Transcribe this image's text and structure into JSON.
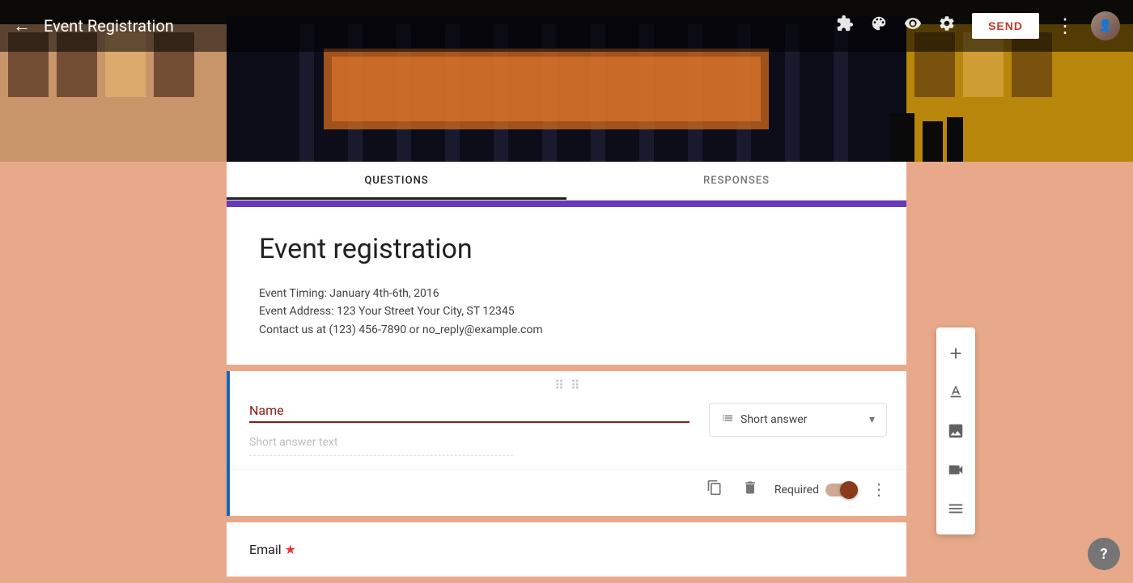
{
  "header": {
    "back_label": "←",
    "title": "Event Registration",
    "send_label": "SEND",
    "icons": {
      "puzzle": "⚙",
      "palette": "🎨",
      "eye": "👁",
      "settings": "⚙",
      "more": "⋮"
    }
  },
  "tabs": [
    {
      "label": "QUESTIONS",
      "active": true
    },
    {
      "label": "RESPONSES",
      "active": false
    }
  ],
  "form": {
    "title": "Event registration",
    "description_line1": "Event Timing: January 4th-6th, 2016",
    "description_line2": "Event Address: 123 Your Street Your City, ST 12345",
    "description_line3": "Contact us at (123) 456-7890 or no_reply@example.com"
  },
  "questions": [
    {
      "label": "Name",
      "answer_placeholder": "Short answer text",
      "type": "Short answer",
      "required": true
    },
    {
      "label": "Email",
      "required": true
    }
  ],
  "toolbar": {
    "add_label": "+",
    "text_label": "Tt",
    "image_label": "🖼",
    "video_label": "▶",
    "section_label": "▬"
  },
  "footer": {
    "required_label": "Required",
    "more_label": "⋮"
  },
  "help": {
    "label": "?"
  }
}
